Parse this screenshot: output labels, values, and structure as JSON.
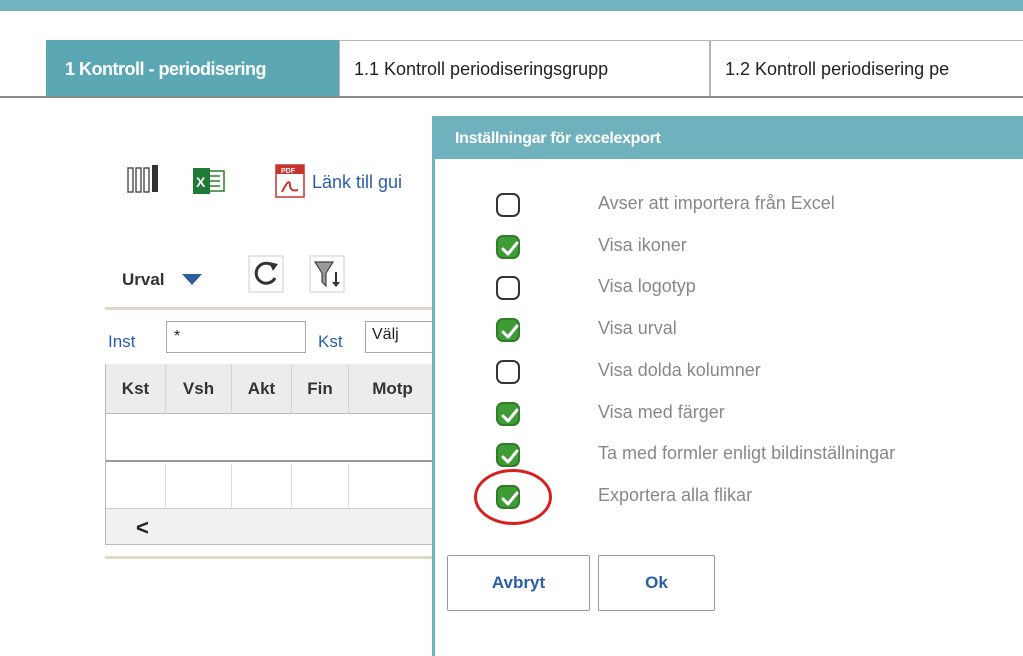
{
  "tabs": [
    {
      "label": "1 Kontroll - periodisering",
      "active": true
    },
    {
      "label": "1.1 Kontroll periodiseringsgrupp",
      "active": false
    },
    {
      "label": "1.2 Kontroll periodisering pe",
      "active": false
    }
  ],
  "toolbar": {
    "link_label": "Länk till gui",
    "icons": [
      "columns-icon",
      "excel-icon",
      "pdf-icon",
      "refresh-icon",
      "filter-icon"
    ]
  },
  "selection": {
    "urval_label": "Urval",
    "inst_label": "Inst",
    "inst_value": "*",
    "kst_label": "Kst",
    "kst_value": "Välj"
  },
  "grid": {
    "columns": [
      "Kst",
      "Vsh",
      "Akt",
      "Fin",
      "Motp"
    ]
  },
  "dialog": {
    "title": "Inställningar för excelexport",
    "options": [
      {
        "label": "Avser att importera från Excel",
        "checked": false
      },
      {
        "label": "Visa ikoner",
        "checked": true
      },
      {
        "label": "Visa logotyp",
        "checked": false
      },
      {
        "label": "Visa urval",
        "checked": true
      },
      {
        "label": "Visa dolda kolumner",
        "checked": false
      },
      {
        "label": "Visa med färger",
        "checked": true
      },
      {
        "label": "Ta med formler enligt bildinställningar",
        "checked": true
      },
      {
        "label": "Exportera alla flikar",
        "checked": true
      }
    ],
    "cancel_label": "Avbryt",
    "ok_label": "Ok"
  },
  "colors": {
    "accent": "#6fb2bd",
    "active_tab": "#5ba7b4",
    "checkbox_checked": "#3f9b35",
    "link": "#2a5ea8",
    "highlight_ring": "#d8201f"
  }
}
